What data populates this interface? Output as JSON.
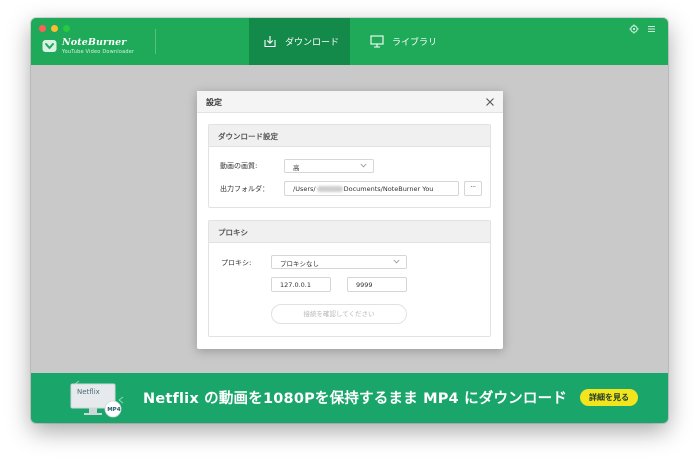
{
  "app": {
    "brand_name": "NoteBurner",
    "brand_subtitle": "YouTube Video Downloader",
    "colors": {
      "header": "#1faa5a",
      "active_tab": "#13894a",
      "banner": "#1aa56b",
      "banner_button": "#f2e51e"
    }
  },
  "toolbar": {
    "tabs": [
      {
        "label": "ダウンロード",
        "icon": "download-icon",
        "active": true
      },
      {
        "label": "ライブラリ",
        "icon": "monitor-icon",
        "active": false
      }
    ],
    "right_icons": [
      "gear-icon",
      "menu-icon"
    ]
  },
  "dialog": {
    "title": "設定",
    "download_section": {
      "title": "ダウンロード設定",
      "quality_label": "動画の画質:",
      "quality_value": "高",
      "folder_label": "出力フォルダ：",
      "folder_prefix": "/Users/",
      "folder_suffix": "Documents/NoteBurner You",
      "browse_label": "···"
    },
    "proxy_section": {
      "title": "プロキシ",
      "proxy_label": "プロキシ:",
      "proxy_value": "プロキシなし",
      "host_value": "127.0.0.1",
      "port_value": "9999",
      "confirm_label": "接続を確認してください"
    }
  },
  "banner": {
    "monitor_text": "Netflix",
    "badge_text": "MP4",
    "title": "Netflix の動画を1080Pを保持するまま MP4 にダウンロード",
    "button_label": "詳細を見る"
  }
}
